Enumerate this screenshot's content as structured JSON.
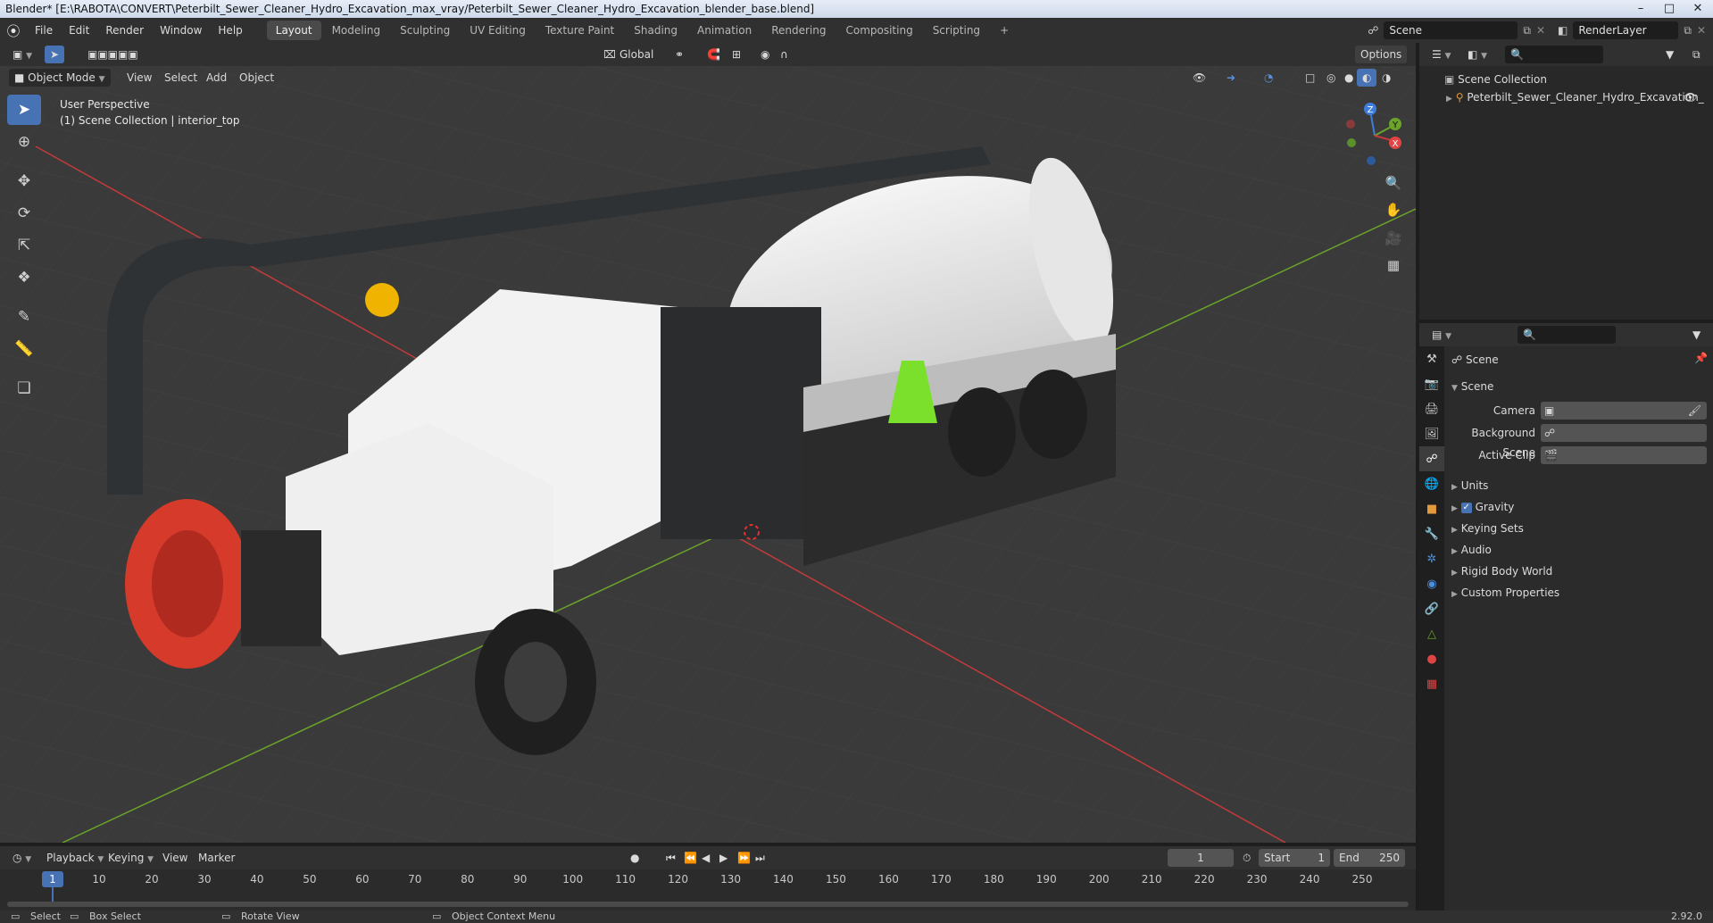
{
  "window": {
    "title": "Blender* [E:\\RABOTA\\CONVERT\\Peterbilt_Sewer_Cleaner_Hydro_Excavation_max_vray/Peterbilt_Sewer_Cleaner_Hydro_Excavation_blender_base.blend]",
    "minimize": "–",
    "maximize": "□",
    "close": "✕"
  },
  "menu": [
    "File",
    "Edit",
    "Render",
    "Window",
    "Help"
  ],
  "workspaces": [
    {
      "label": "Layout",
      "active": true
    },
    {
      "label": "Modeling"
    },
    {
      "label": "Sculpting"
    },
    {
      "label": "UV Editing"
    },
    {
      "label": "Texture Paint"
    },
    {
      "label": "Shading"
    },
    {
      "label": "Animation"
    },
    {
      "label": "Rendering"
    },
    {
      "label": "Compositing"
    },
    {
      "label": "Scripting"
    }
  ],
  "add_workspace": "+",
  "scene_selector": "Scene",
  "renderlayer_selector": "RenderLayer",
  "viewport": {
    "transform_orientation": "Global",
    "options_label": "Options",
    "mode": "Object Mode",
    "menus": [
      "View",
      "Select",
      "Add",
      "Object"
    ],
    "perspective_label": "User Perspective",
    "collection_label": "(1) Scene Collection | interior_top",
    "gizmo_axes": [
      "Z",
      "Y",
      "X"
    ]
  },
  "outliner": {
    "root": "Scene Collection",
    "items": [
      "Peterbilt_Sewer_Cleaner_Hydro_Excavation_"
    ]
  },
  "properties": {
    "context_title": "Scene",
    "panel_title": "Scene",
    "fields": [
      "Camera",
      "Background Scene",
      "Active Clip"
    ],
    "subpanels": [
      {
        "label": "Units"
      },
      {
        "label": "Gravity",
        "checkbox": true
      },
      {
        "label": "Keying Sets"
      },
      {
        "label": "Audio"
      },
      {
        "label": "Rigid Body World"
      },
      {
        "label": "Custom Properties"
      }
    ]
  },
  "timeline": {
    "menus": [
      "Playback",
      "Keying",
      "View",
      "Marker"
    ],
    "current_frame": "1",
    "start_label": "Start",
    "start": "1",
    "end_label": "End",
    "end": "250",
    "ticks": [
      "1",
      "10",
      "20",
      "30",
      "40",
      "50",
      "60",
      "70",
      "80",
      "90",
      "100",
      "110",
      "120",
      "130",
      "140",
      "150",
      "160",
      "170",
      "180",
      "190",
      "200",
      "210",
      "220",
      "230",
      "240",
      "250"
    ]
  },
  "statusbar": {
    "select": "Select",
    "box_select": "Box Select",
    "rotate_view": "Rotate View",
    "context_menu": "Object Context Menu",
    "version": "2.92.0"
  },
  "colors": {
    "accent": "#4772b3",
    "viewport_bg": "#3a3a3a",
    "x_axis": "#c33a3a",
    "y_axis": "#6ba32b",
    "z_axis": "#3f7ddb",
    "cone": "#7be02c",
    "hose_reel": "#d63a2a"
  }
}
